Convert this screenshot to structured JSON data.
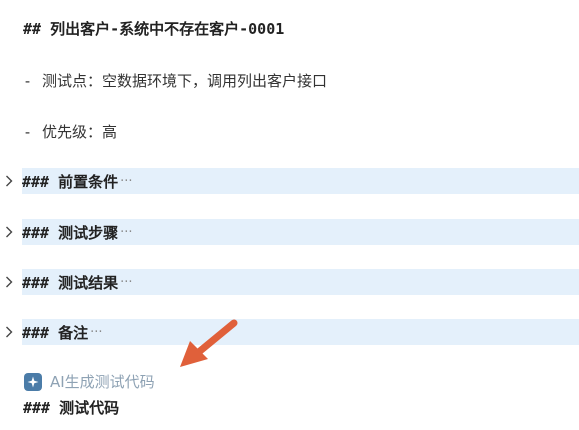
{
  "doc": {
    "heading": "## 列出客户-系统中不存在客户-0001",
    "bullets": [
      {
        "dash": "-",
        "text": "测试点：空数据环境下，调用列出客户接口"
      },
      {
        "dash": "-",
        "text": "优先级：高"
      }
    ],
    "sections": [
      {
        "title": "### 前置条件",
        "ellipsis": "···"
      },
      {
        "title": "### 测试步骤",
        "ellipsis": "···"
      },
      {
        "title": "### 测试结果",
        "ellipsis": "···"
      },
      {
        "title": "### 备注",
        "ellipsis": "···"
      }
    ],
    "ai_button": {
      "label": "AI生成测试代码",
      "icon": "sparkle-icon"
    },
    "code_heading": "### 测试代码"
  },
  "colors": {
    "section_band": "#e4f0fb",
    "ai_text": "#8ea2b4",
    "ai_icon_bg": "#4b7ca8",
    "annotation_arrow": "#e0603a"
  }
}
